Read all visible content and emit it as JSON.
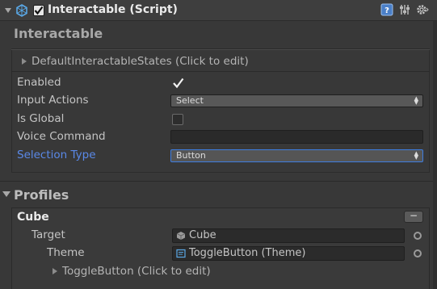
{
  "header": {
    "component_title": "Interactable (Script)",
    "enabled": true
  },
  "interactable": {
    "section_title": "Interactable",
    "states_foldout": "DefaultInteractableStates (Click to edit)",
    "fields": {
      "enabled_label": "Enabled",
      "enabled_value": true,
      "input_actions_label": "Input Actions",
      "input_actions_value": "Select",
      "is_global_label": "Is Global",
      "is_global_value": false,
      "voice_command_label": "Voice Command",
      "voice_command_value": "",
      "selection_type_label": "Selection Type",
      "selection_type_value": "Button"
    }
  },
  "profiles": {
    "section_title": "Profiles",
    "profile_name": "Cube",
    "remove_label": "−",
    "target_label": "Target",
    "target_value": "Cube",
    "theme_label": "Theme",
    "theme_value": "ToggleButton (Theme)",
    "theme_foldout": "ToggleButton (Click to edit)"
  },
  "colors": {
    "background": "#383838",
    "selection_accent": "#3e7de0",
    "selection_label": "#5a89e8"
  }
}
